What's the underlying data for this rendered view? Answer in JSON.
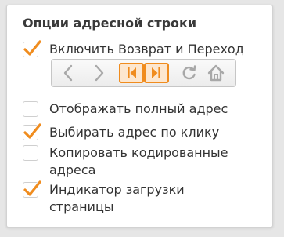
{
  "section": {
    "title": "Опции адресной строки"
  },
  "options": [
    {
      "label": "Включить Возврат и Переход",
      "checked": true
    },
    {
      "label": "Отображать полный адрес",
      "checked": false
    },
    {
      "label": "Выбирать адрес по клику",
      "checked": true
    },
    {
      "label": "Копировать кодированные адреса",
      "checked": false
    },
    {
      "label": "Индикатор загрузки страницы",
      "checked": true
    }
  ],
  "nav_buttons": [
    {
      "icon": "back-arrow-icon",
      "selected": false
    },
    {
      "icon": "forward-arrow-icon",
      "selected": false
    },
    {
      "icon": "rewind-icon",
      "selected": true
    },
    {
      "icon": "fast-forward-icon",
      "selected": true
    },
    {
      "icon": "reload-icon",
      "selected": false
    },
    {
      "icon": "home-icon",
      "selected": false
    }
  ],
  "colors": {
    "accent": "#f08c1e",
    "selected_fill": "#fde7cf",
    "icon_gray": "#a8a8a8",
    "text": "#333333"
  }
}
